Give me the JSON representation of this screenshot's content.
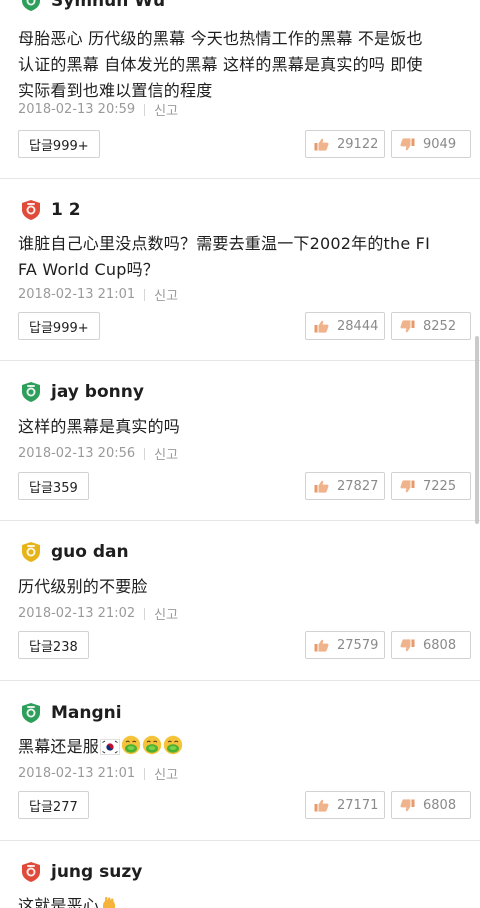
{
  "comments": [
    {
      "author": "Symnun Wu",
      "badge": "green",
      "text_lines": [
        "母胎恶心 历代级的黑幕 今天也热情工作的黑幕 不是饭也",
        "认证的黑幕 自体发光的黑幕 这样的黑幕是真实的吗 即使",
        "实际看到也难以置信的程度"
      ],
      "date": "2018-02-13 20:59",
      "report": "신고",
      "reply": "답글999+",
      "likes": "29122",
      "dislikes": "9049"
    },
    {
      "author": "1 2",
      "badge": "red",
      "text_lines": [
        "谁脏自己心里没点数吗？需要去重温一下2002年的the FI",
        "FA World Cup吗？"
      ],
      "date": "2018-02-13 21:01",
      "report": "신고",
      "reply": "답글999+",
      "likes": "28444",
      "dislikes": "8252"
    },
    {
      "author": "jay bonny",
      "badge": "green",
      "text_lines": [
        "这样的黑幕是真实的吗"
      ],
      "date": "2018-02-13 20:56",
      "report": "신고",
      "reply": "답글359",
      "likes": "27827",
      "dislikes": "7225"
    },
    {
      "author": "guo dan",
      "badge": "gold",
      "text_lines": [
        "历代级别的不要脸"
      ],
      "date": "2018-02-13 21:02",
      "report": "신고",
      "reply": "답글238",
      "likes": "27579",
      "dislikes": "6808"
    },
    {
      "author": "Mangni",
      "badge": "green",
      "text_lines": [
        "黑幕还是服"
      ],
      "date": "2018-02-13 21:01",
      "report": "신고",
      "reply": "답글277",
      "likes": "27171",
      "dislikes": "6808"
    },
    {
      "author": "jung suzy",
      "badge": "red",
      "text_lines": [
        "这就是恶心"
      ],
      "date": "",
      "report": "",
      "reply": "",
      "likes": "",
      "dislikes": ""
    }
  ],
  "colors": {
    "badge_green": "#2e9e5b",
    "badge_red": "#e04a3a",
    "badge_gold": "#e6b319",
    "like_icon": "#e59b6e",
    "dislike_icon": "#e59b6e"
  },
  "icons": {
    "like": "thumbs-up-icon",
    "dislike": "thumbs-down-icon",
    "flag": "korean-flag-icon",
    "sick_face": "nauseated-face-icon",
    "pointing_hand": "hand-icon"
  }
}
